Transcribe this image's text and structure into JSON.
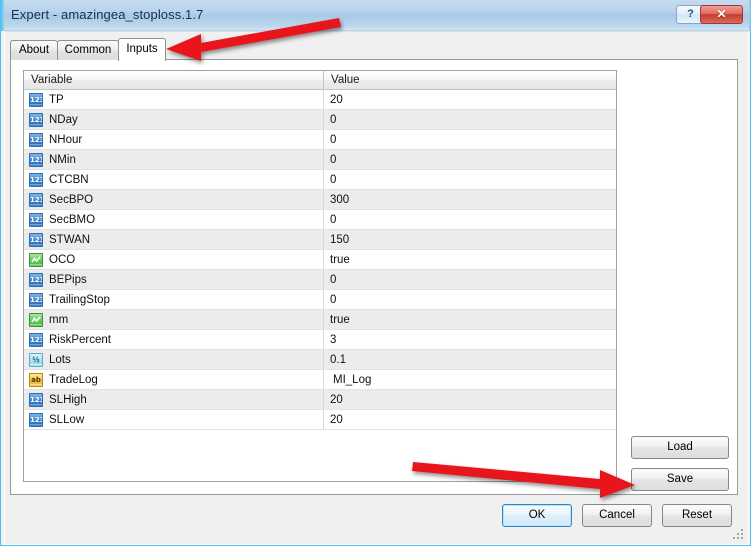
{
  "window": {
    "title": "Expert - amazingea_stoploss.1.7",
    "help_button": "?",
    "close_button": "✕",
    "accent_border": "#4cc2f0",
    "titlebar_color": "#a8c9e6"
  },
  "tabs": [
    {
      "label": "About",
      "active": false
    },
    {
      "label": "Common",
      "active": false
    },
    {
      "label": "Inputs",
      "active": true
    }
  ],
  "table": {
    "columns": [
      "Variable",
      "Value"
    ],
    "rows": [
      {
        "icon": "int-type-icon",
        "icon_glyph": "123",
        "variable": "TP",
        "value": "20"
      },
      {
        "icon": "int-type-icon",
        "icon_glyph": "123",
        "variable": "NDay",
        "value": "0"
      },
      {
        "icon": "int-type-icon",
        "icon_glyph": "123",
        "variable": "NHour",
        "value": "0"
      },
      {
        "icon": "int-type-icon",
        "icon_glyph": "123",
        "variable": "NMin",
        "value": "0"
      },
      {
        "icon": "int-type-icon",
        "icon_glyph": "123",
        "variable": "CTCBN",
        "value": "0"
      },
      {
        "icon": "int-type-icon",
        "icon_glyph": "123",
        "variable": "SecBPO",
        "value": "300"
      },
      {
        "icon": "int-type-icon",
        "icon_glyph": "123",
        "variable": "SecBMO",
        "value": "0"
      },
      {
        "icon": "int-type-icon",
        "icon_glyph": "123",
        "variable": "STWAN",
        "value": "150"
      },
      {
        "icon": "bool-type-icon",
        "icon_glyph": "",
        "variable": "OCO",
        "value": "true"
      },
      {
        "icon": "int-type-icon",
        "icon_glyph": "123",
        "variable": "BEPips",
        "value": "0"
      },
      {
        "icon": "int-type-icon",
        "icon_glyph": "123",
        "variable": "TrailingStop",
        "value": "0"
      },
      {
        "icon": "bool-type-icon",
        "icon_glyph": "",
        "variable": "mm",
        "value": "true"
      },
      {
        "icon": "int-type-icon",
        "icon_glyph": "123",
        "variable": "RiskPercent",
        "value": "3"
      },
      {
        "icon": "double-type-icon",
        "icon_glyph": "½",
        "variable": "Lots",
        "value": "0.1"
      },
      {
        "icon": "string-type-icon",
        "icon_glyph": "ab",
        "variable": "TradeLog",
        "value": "MI_Log"
      },
      {
        "icon": "int-type-icon",
        "icon_glyph": "123",
        "variable": "SLHigh",
        "value": "20"
      },
      {
        "icon": "int-type-icon",
        "icon_glyph": "123",
        "variable": "SLLow",
        "value": "20"
      }
    ]
  },
  "side_buttons": {
    "load": "Load",
    "save": "Save"
  },
  "dialog_buttons": {
    "ok": "OK",
    "cancel": "Cancel",
    "reset": "Reset"
  },
  "annotations": {
    "color": "#e8141a",
    "arrow_inputs_tab": "arrow pointing to Inputs tab",
    "arrow_save_button": "arrow pointing to Save button"
  }
}
